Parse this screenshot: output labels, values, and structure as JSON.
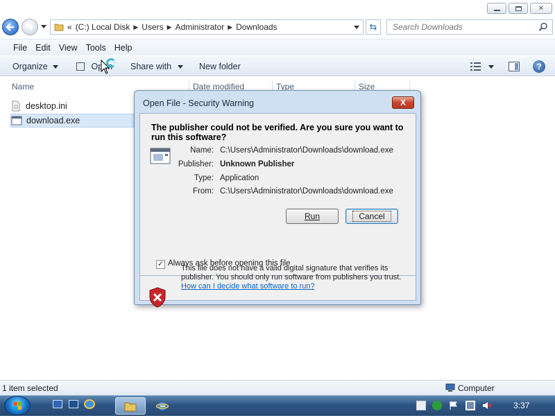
{
  "window": {
    "minimize_glyph": "–",
    "maximize_glyph": "❐",
    "close_glyph": "✕"
  },
  "nav": {
    "address_prefix": "«",
    "crumbs": [
      "(C:) Local Disk",
      "Users",
      "Administrator",
      "Downloads"
    ],
    "search_placeholder": "Search Downloads"
  },
  "menubar": {
    "items": [
      "File",
      "Edit",
      "View",
      "Tools",
      "Help"
    ]
  },
  "commandbar": {
    "organize": "Organize",
    "open": "Open",
    "share_with": "Share with",
    "new_folder": "New folder"
  },
  "columns": {
    "name": "Name",
    "date_modified": "Date modified",
    "type": "Type",
    "size": "Size"
  },
  "files": [
    {
      "name": "desktop.ini",
      "selected": false,
      "icon": "settings-file-icon"
    },
    {
      "name": "download.exe",
      "selected": true,
      "icon": "application-icon"
    }
  ],
  "status": {
    "selection": "1 item selected",
    "location": "Computer"
  },
  "taskbar": {
    "clock": "3:37"
  },
  "dialog": {
    "title": "Open File - Security Warning",
    "close_label": "X",
    "question": "The publisher could not be verified.  Are you sure you want to run this software?",
    "fields": [
      {
        "label": "Name:",
        "value": "C:\\Users\\Administrator\\Downloads\\download.exe",
        "bold": false
      },
      {
        "label": "Publisher:",
        "value": "Unknown Publisher",
        "bold": true
      },
      {
        "label": "Type:",
        "value": "Application",
        "bold": false
      },
      {
        "label": "From:",
        "value": "C:\\Users\\Administrator\\Downloads\\download.exe",
        "bold": false
      }
    ],
    "run_button": "Run",
    "cancel_button": "Cancel",
    "checkbox_checked": true,
    "checkbox_label": "Always ask before opening this file",
    "warning_text": "This file does not have a valid digital signature that verifies its publisher.  You should only run software from publishers you trust.",
    "warning_link": "How can I decide what software to run?"
  },
  "colors": {
    "accent": "#2f6ec3",
    "shield_red": "#c8252b",
    "link": "#0b63c5"
  }
}
